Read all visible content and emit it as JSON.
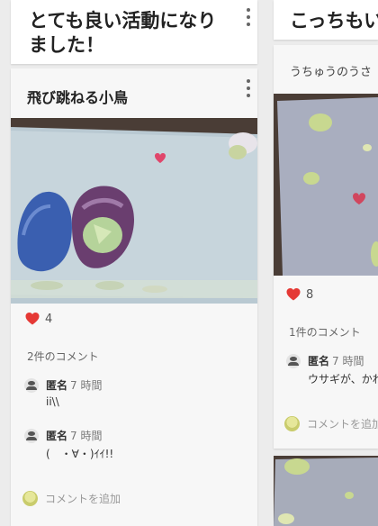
{
  "left_column": {
    "header": {
      "title": "とても良い活動になりました！"
    },
    "post": {
      "title": "飛び跳ねる小鳥",
      "likes": "4",
      "comment_count": "2件のコメント",
      "comments": [
        {
          "name": "匿名",
          "time": "7 時間",
          "text": "ii\\\\"
        },
        {
          "name": "匿名",
          "time": "7 時間",
          "text": "(　・∀・)ｲｲ!!"
        }
      ],
      "add_comment": "コメントを追加"
    }
  },
  "right_column": {
    "header": {
      "title": "こっちもい"
    },
    "post": {
      "subtitle": "うちゅうのうさ",
      "likes": "8",
      "comment_count": "1件のコメント",
      "comments": [
        {
          "name": "匿名",
          "time": "7 時間",
          "text": "ウサギが、かわ"
        }
      ],
      "add_comment": "コメントを追加"
    }
  },
  "colors": {
    "heart": "#e53935",
    "card": "#f7f7f7",
    "background": "#ececec"
  }
}
